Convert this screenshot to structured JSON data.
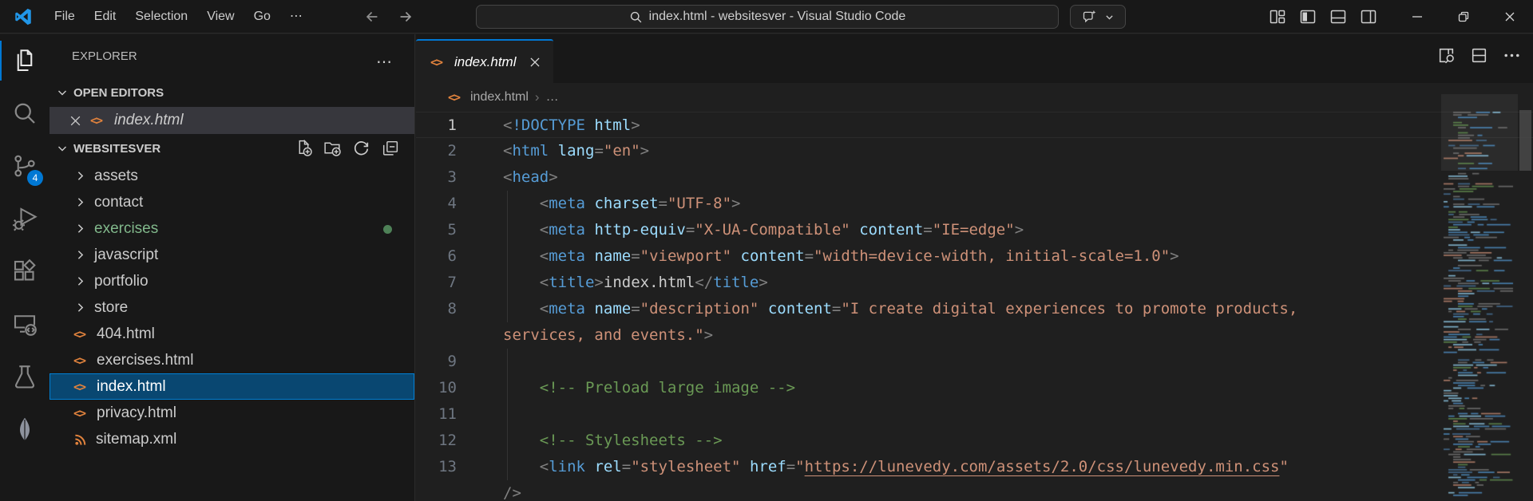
{
  "titlebar": {
    "menus": [
      "File",
      "Edit",
      "Selection",
      "View",
      "Go",
      "⋯"
    ],
    "command_center": {
      "text": "index.html - websitesver - Visual Studio Code"
    }
  },
  "activity_bar": {
    "items": [
      "explorer",
      "search",
      "source-control",
      "run-and-debug",
      "extensions",
      "remote-explorer",
      "testing",
      "mongodb"
    ],
    "source_control_badge": "4"
  },
  "sidebar": {
    "title": "EXPLORER",
    "more": "⋯",
    "open_editors_label": "OPEN EDITORS",
    "open_editors": [
      {
        "label": "index.html",
        "icon": "html",
        "preview": true
      }
    ],
    "workspace_label": "WEBSITESVER",
    "tree": [
      {
        "type": "folder",
        "label": "assets"
      },
      {
        "type": "folder",
        "label": "contact"
      },
      {
        "type": "folder",
        "label": "exercises",
        "green": true,
        "dot": true
      },
      {
        "type": "folder",
        "label": "javascript"
      },
      {
        "type": "folder",
        "label": "portfolio"
      },
      {
        "type": "folder",
        "label": "store"
      },
      {
        "type": "file",
        "icon": "html",
        "label": "404.html"
      },
      {
        "type": "file",
        "icon": "html",
        "label": "exercises.html"
      },
      {
        "type": "file",
        "icon": "html",
        "label": "index.html",
        "selected": true
      },
      {
        "type": "file",
        "icon": "html",
        "label": "privacy.html"
      },
      {
        "type": "file",
        "icon": "xml",
        "label": "sitemap.xml"
      }
    ]
  },
  "editor": {
    "tab": {
      "label": "index.html"
    },
    "breadcrumb": {
      "file": "index.html",
      "more": "…"
    },
    "code_rows": [
      {
        "n": "1",
        "a": 1,
        "t": [
          [
            "p",
            "<"
          ],
          [
            "tg",
            "!DOCTYPE"
          ],
          [
            "d",
            " "
          ],
          [
            "at",
            "html"
          ],
          [
            "p",
            ">"
          ]
        ]
      },
      {
        "n": "2",
        "t": [
          [
            "p",
            "<"
          ],
          [
            "tg",
            "html"
          ],
          [
            "d",
            " "
          ],
          [
            "at",
            "lang"
          ],
          [
            "p",
            "="
          ],
          [
            "s",
            "\"en\""
          ],
          [
            "p",
            ">"
          ]
        ]
      },
      {
        "n": "3",
        "t": [
          [
            "p",
            "<"
          ],
          [
            "tg",
            "head"
          ],
          [
            "p",
            ">"
          ]
        ]
      },
      {
        "n": "4",
        "g": 1,
        "t": [
          [
            "d",
            "    "
          ],
          [
            "p",
            "<"
          ],
          [
            "tg",
            "meta"
          ],
          [
            "d",
            " "
          ],
          [
            "at",
            "charset"
          ],
          [
            "p",
            "="
          ],
          [
            "s",
            "\"UTF-8\""
          ],
          [
            "p",
            ">"
          ]
        ]
      },
      {
        "n": "5",
        "g": 1,
        "t": [
          [
            "d",
            "    "
          ],
          [
            "p",
            "<"
          ],
          [
            "tg",
            "meta"
          ],
          [
            "d",
            " "
          ],
          [
            "at",
            "http-equiv"
          ],
          [
            "p",
            "="
          ],
          [
            "s",
            "\"X-UA-Compatible\""
          ],
          [
            "d",
            " "
          ],
          [
            "at",
            "content"
          ],
          [
            "p",
            "="
          ],
          [
            "s",
            "\"IE=edge\""
          ],
          [
            "p",
            ">"
          ]
        ]
      },
      {
        "n": "6",
        "g": 1,
        "t": [
          [
            "d",
            "    "
          ],
          [
            "p",
            "<"
          ],
          [
            "tg",
            "meta"
          ],
          [
            "d",
            " "
          ],
          [
            "at",
            "name"
          ],
          [
            "p",
            "="
          ],
          [
            "s",
            "\"viewport\""
          ],
          [
            "d",
            " "
          ],
          [
            "at",
            "content"
          ],
          [
            "p",
            "="
          ],
          [
            "s",
            "\"width=device-width, initial-scale=1.0\""
          ],
          [
            "p",
            ">"
          ]
        ]
      },
      {
        "n": "7",
        "g": 1,
        "t": [
          [
            "d",
            "    "
          ],
          [
            "p",
            "<"
          ],
          [
            "tg",
            "title"
          ],
          [
            "p",
            ">"
          ],
          [
            "tx",
            "index.html"
          ],
          [
            "p",
            "</"
          ],
          [
            "tg",
            "title"
          ],
          [
            "p",
            ">"
          ]
        ]
      },
      {
        "n": "8",
        "g": 1,
        "t": [
          [
            "d",
            "    "
          ],
          [
            "p",
            "<"
          ],
          [
            "tg",
            "meta"
          ],
          [
            "d",
            " "
          ],
          [
            "at",
            "name"
          ],
          [
            "p",
            "="
          ],
          [
            "s",
            "\"description\""
          ],
          [
            "d",
            " "
          ],
          [
            "at",
            "content"
          ],
          [
            "p",
            "="
          ],
          [
            "s",
            "\"I create digital experiences to promote products,"
          ]
        ]
      },
      {
        "n": "",
        "t": [
          [
            "s",
            "services, and events.\""
          ],
          [
            "p",
            ">"
          ]
        ]
      },
      {
        "n": "9",
        "g": 1,
        "t": []
      },
      {
        "n": "10",
        "g": 1,
        "t": [
          [
            "d",
            "    "
          ],
          [
            "cm",
            "<!-- Preload large image -->"
          ]
        ]
      },
      {
        "n": "11",
        "g": 1,
        "t": []
      },
      {
        "n": "12",
        "g": 1,
        "t": [
          [
            "d",
            "    "
          ],
          [
            "cm",
            "<!-- Stylesheets -->"
          ]
        ]
      },
      {
        "n": "13",
        "g": 1,
        "t": [
          [
            "d",
            "    "
          ],
          [
            "p",
            "<"
          ],
          [
            "tg",
            "link"
          ],
          [
            "d",
            " "
          ],
          [
            "at",
            "rel"
          ],
          [
            "p",
            "="
          ],
          [
            "s",
            "\"stylesheet\""
          ],
          [
            "d",
            " "
          ],
          [
            "at",
            "href"
          ],
          [
            "p",
            "="
          ],
          [
            "s",
            "\""
          ],
          [
            "lk",
            "https://lunevedy.com/assets/2.0/css/lunevedy.min.css"
          ],
          [
            "s",
            "\""
          ]
        ]
      },
      {
        "n": "",
        "t": [
          [
            "p",
            "/>"
          ]
        ]
      }
    ]
  },
  "colors": {
    "accent": "#0078d4",
    "titlebar_bg": "#181818",
    "sidebar_bg": "#181818",
    "editor_bg": "#1f1f1f",
    "selection_bg": "#094771",
    "badge": "#0078d4",
    "html_icon": "#e0823d",
    "git_untracked_green": "#81b88b",
    "syntax_tag": "#569cd6",
    "syntax_attribute": "#9cdcfe",
    "syntax_string": "#ce9178",
    "syntax_comment": "#6a9955",
    "syntax_punctuation": "#808080"
  }
}
